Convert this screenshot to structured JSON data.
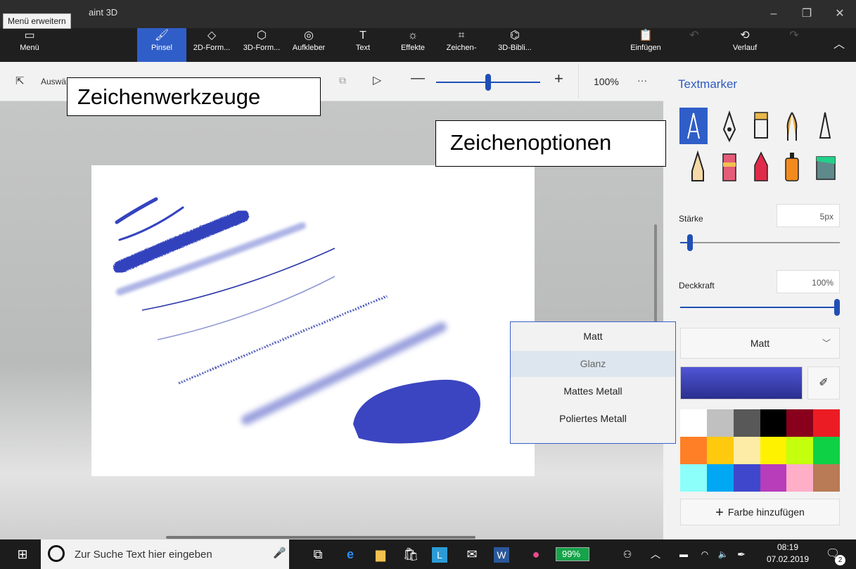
{
  "tooltip": "Menü erweitern",
  "app_title": "aint 3D",
  "menu_label": "Menü",
  "tools": [
    {
      "label": "Pinsel",
      "icon": "brush-icon"
    },
    {
      "label": "2D-Form...",
      "icon": "2d-shapes-icon"
    },
    {
      "label": "3D-Form...",
      "icon": "3d-shapes-icon"
    },
    {
      "label": "Aufkleber",
      "icon": "sticker-icon"
    },
    {
      "label": "Text",
      "icon": "text-icon"
    },
    {
      "label": "Effekte",
      "icon": "effects-icon"
    },
    {
      "label": "Zeichen-",
      "icon": "canvas-icon"
    },
    {
      "label": "3D-Bibli...",
      "icon": "3d-library-icon"
    }
  ],
  "paste_label": "Einfügen",
  "history_label": "Verlauf",
  "select_label": "Auswä",
  "zoom_value": "100%",
  "zoom_level": 0.5,
  "more_label": "···",
  "callout_tools": "Zeichenwerkzeuge",
  "callout_options": "Zeichenoptionen",
  "panel": {
    "title": "Textmarker",
    "strength_label": "Stärke",
    "strength_value": "5px",
    "strength_level": 0.05,
    "opacity_label": "Deckkraft",
    "opacity_value": "100%",
    "opacity_level": 1.0,
    "finish_selected": "Matt",
    "add_color_label": "Farbe hinzufügen",
    "current_color": "#3b3fc4",
    "palette": [
      "#ffffff",
      "#c0c0c0",
      "#585858",
      "#000000",
      "#88001b",
      "#ec1c24",
      "#ff7f27",
      "#ffc90e",
      "#fdeca6",
      "#fff200",
      "#c4ff0e",
      "#0ed145",
      "#8cfffb",
      "#00a8f3",
      "#3f48cc",
      "#b83dba",
      "#ffaec8",
      "#b97a56"
    ]
  },
  "finish_options": [
    "Matt",
    "Glanz",
    "Mattes Metall",
    "Poliertes Metall"
  ],
  "taskbar": {
    "search_placeholder": "Zur Suche Text hier eingeben",
    "battery": "99%",
    "time": "08:19",
    "date": "07.02.2019",
    "notifications": "2"
  }
}
